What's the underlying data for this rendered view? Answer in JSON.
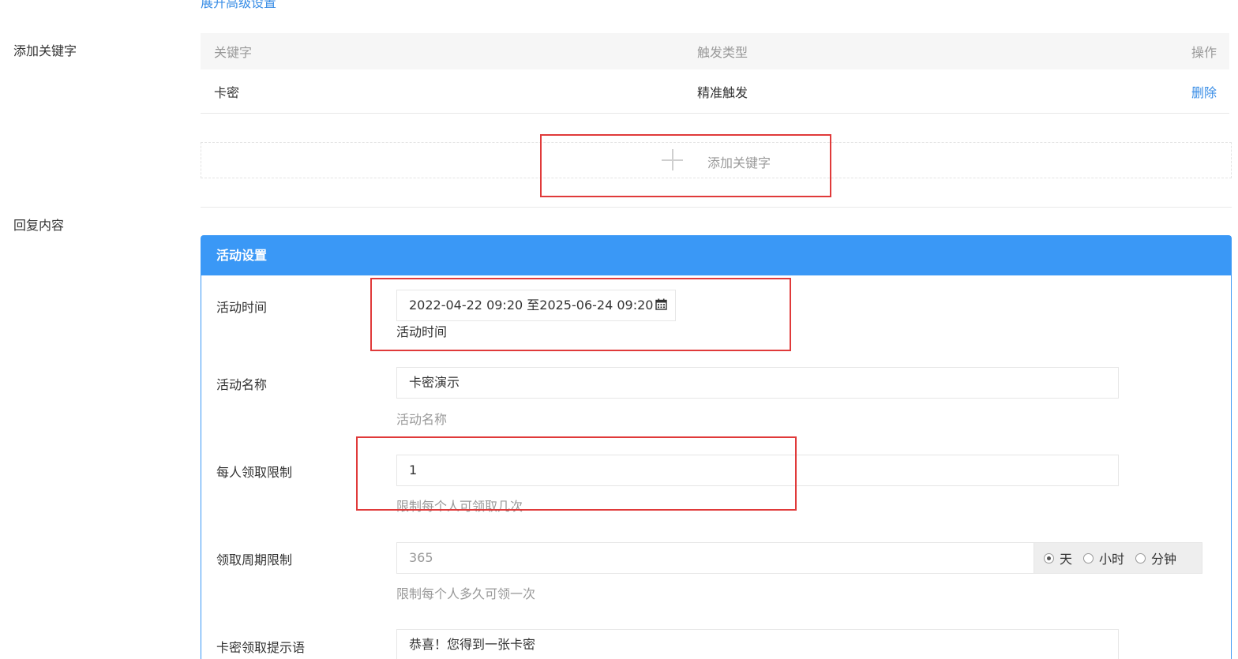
{
  "top_link": "展开高级设置",
  "keywords_section": {
    "label": "添加关键字",
    "columns": [
      "关键字",
      "触发类型",
      "操作"
    ],
    "rows": [
      {
        "keyword": "卡密",
        "trigger": "精准触发",
        "action": "删除"
      }
    ],
    "add_button_label": "添加关键字"
  },
  "reply_section": {
    "label": "回复内容",
    "panel_title": "活动设置",
    "fields": {
      "time": {
        "label": "活动时间",
        "value": "2022-04-22 09:20 至2025-06-24 09:20",
        "help": "活动时间"
      },
      "name": {
        "label": "活动名称",
        "value": "卡密演示",
        "help": "活动名称"
      },
      "limit": {
        "label": "每人领取限制",
        "value": "1",
        "help": "限制每个人可领取几次"
      },
      "period": {
        "label": "领取周期限制",
        "placeholder": "365",
        "help": "限制每个人多久可领一次",
        "units": [
          {
            "label": "天",
            "selected": true
          },
          {
            "label": "小时",
            "selected": false
          },
          {
            "label": "分钟",
            "selected": false
          }
        ]
      },
      "tip": {
        "label": "卡密领取提示语",
        "value": "恭喜！您得到一张卡密"
      }
    }
  },
  "colors": {
    "accent": "#3a98f6",
    "link": "#3a8ee6",
    "highlight": "#e03a3a"
  }
}
